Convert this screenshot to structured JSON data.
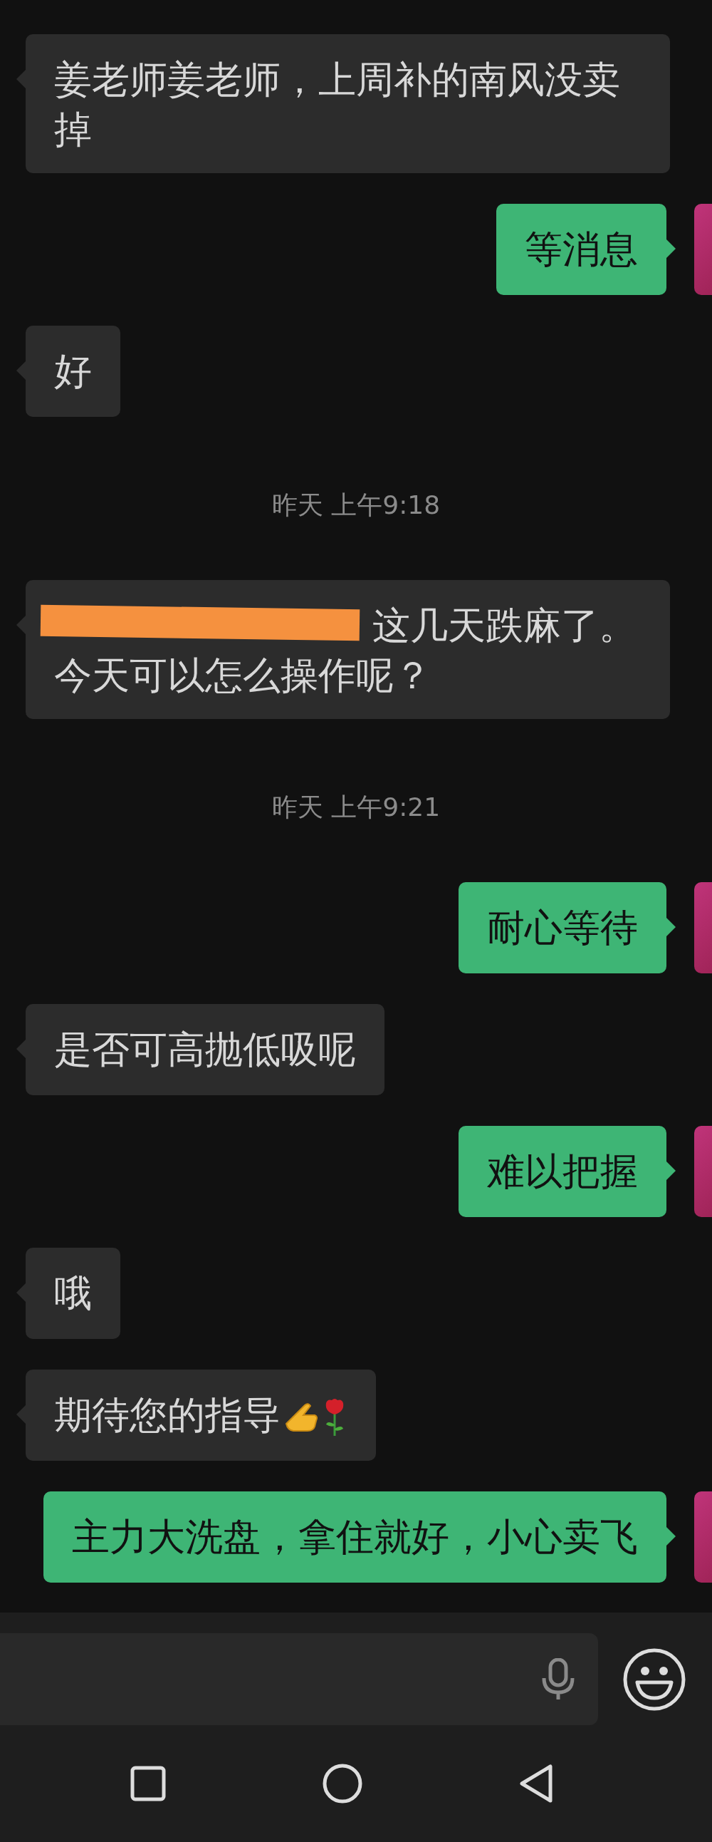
{
  "messages": [
    {
      "kind": "incoming",
      "text": "姜老师姜老师，上周补的南风没卖掉"
    },
    {
      "kind": "outgoing",
      "text": "等消息"
    },
    {
      "kind": "incoming",
      "text": "好"
    },
    {
      "kind": "time",
      "text": "昨天 上午9:18"
    },
    {
      "kind": "incoming",
      "redacted": true,
      "text": "这几天跌麻了。今天可以怎么操作呢？"
    },
    {
      "kind": "time",
      "text": "昨天 上午9:21"
    },
    {
      "kind": "outgoing",
      "text": "耐心等待"
    },
    {
      "kind": "incoming",
      "text": "是否可高抛低吸呢"
    },
    {
      "kind": "outgoing",
      "text": "难以把握"
    },
    {
      "kind": "incoming",
      "text": "哦"
    },
    {
      "kind": "incoming",
      "text": "期待您的指导",
      "emoji": [
        {
          "kind": "hand"
        },
        {
          "kind": "rose"
        }
      ]
    },
    {
      "kind": "outgoing",
      "text": "主力大洗盘，拿住就好，小心卖飞"
    }
  ]
}
